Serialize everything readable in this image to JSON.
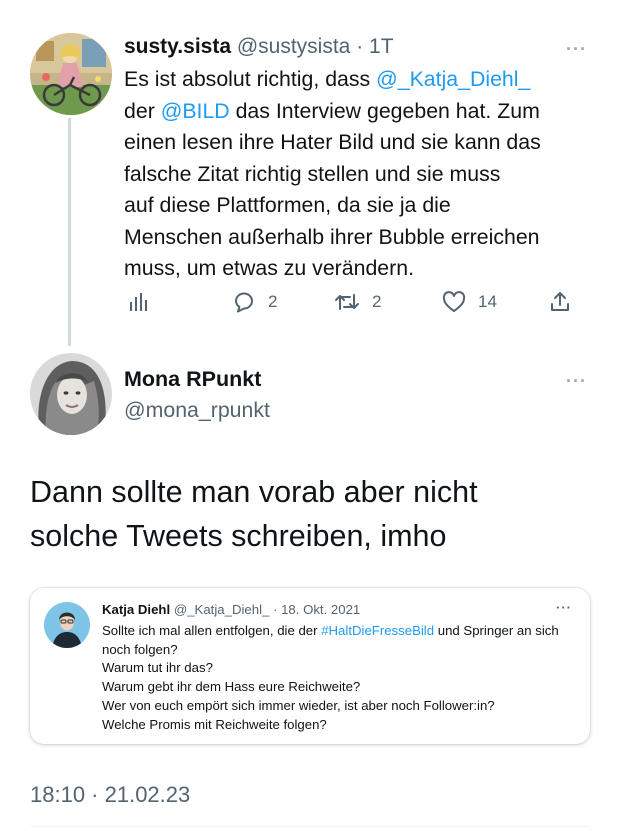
{
  "reply_tweet": {
    "display_name": "susty.sista",
    "handle": "@sustysista",
    "separator": "·",
    "time": "1T",
    "more": "···",
    "body_segments": [
      {
        "text": "Es ist absolut richtig, dass ",
        "link": false
      },
      {
        "text": "@_Katja_Diehl_",
        "link": true
      },
      {
        "text": "\nder ",
        "link": false
      },
      {
        "text": "@BILD",
        "link": true
      },
      {
        "text": " das Interview gegeben hat. Zum\neinen lesen ihre Hater Bild und sie kann das\nfalsche Zitat richtig stellen und sie muss\nauf diese Plattformen, da sie ja die\nMenschen außerhalb ihrer Bubble erreichen\nmuss, um etwas zu verändern.",
        "link": false
      }
    ],
    "actions": {
      "replies": "2",
      "retweets": "2",
      "likes": "14"
    },
    "icons": [
      "analytics-icon",
      "reply-icon",
      "retweet-icon",
      "like-icon",
      "share-icon"
    ]
  },
  "main_tweet": {
    "display_name": "Mona RPunkt",
    "handle": "@mona_rpunkt",
    "more": "···",
    "body": "Dann sollte man vorab aber nicht\nsolche Tweets schreiben, imho",
    "timestamp": "18:10 · 21.02.23"
  },
  "quoted_tweet": {
    "display_name": "Katja Diehl",
    "handle": "@_Katja_Diehl_",
    "separator": "·",
    "date": "18. Okt. 2021",
    "more": "···",
    "line1_before": "Sollte ich mal allen entfolgen, die der ",
    "line1_hashtag": "#HaltDieFresseBild",
    "line1_after": " und Springer an sich noch folgen?",
    "lines": [
      "Warum tut ihr das?",
      "Warum gebt ihr dem Hass eure Reichweite?",
      "Wer von euch empört sich immer wieder, ist aber noch Follower:in?",
      "Welche Promis mit Reichweite folgen?"
    ]
  },
  "colors": {
    "link": "#1d9bf0",
    "text": "#0f1419",
    "secondary": "#536471",
    "thread_line": "#cfd9de"
  }
}
